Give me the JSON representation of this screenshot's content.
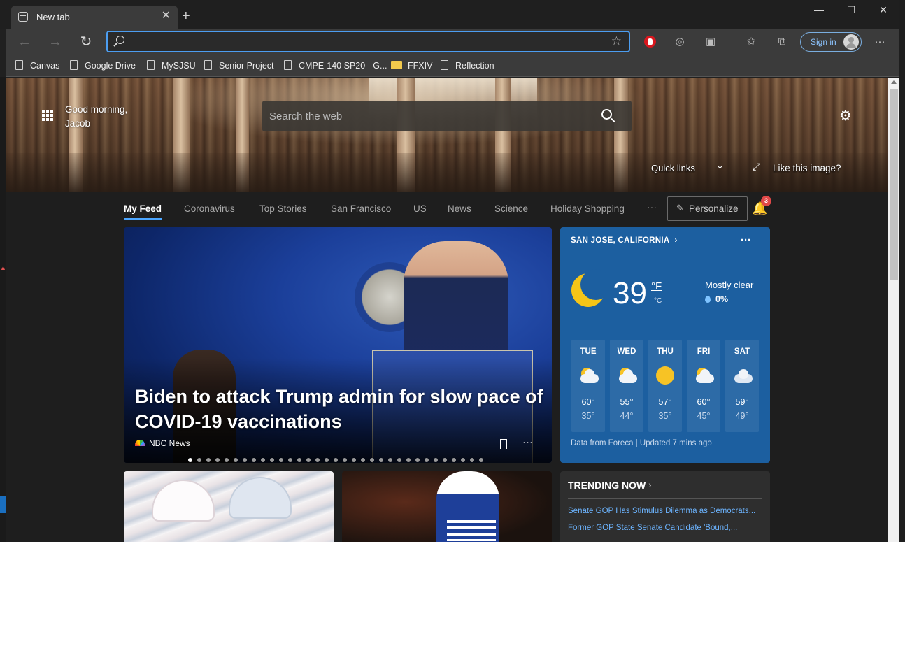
{
  "browser": {
    "tab_title": "New tab",
    "new_tab_symbol": "+",
    "window_controls": [
      "—",
      "☐",
      "✕"
    ],
    "address": {
      "value": "",
      "placeholder": ""
    },
    "sign_in_label": "Sign in",
    "bookmarks": [
      {
        "label": "Canvas",
        "icon": "page-icon"
      },
      {
        "label": "Google Drive",
        "icon": "page-icon"
      },
      {
        "label": "MySJSU",
        "icon": "page-icon"
      },
      {
        "label": "Senior Project",
        "icon": "page-icon"
      },
      {
        "label": "CMPE-140 SP20 - G...",
        "icon": "page-icon"
      },
      {
        "label": "FFXIV",
        "icon": "folder-icon"
      },
      {
        "label": "Reflection",
        "icon": "page-icon"
      }
    ]
  },
  "hero": {
    "greeting": "Good morning, Jacob",
    "search_placeholder": "Search the web",
    "quick_links_label": "Quick links",
    "like_image_label": "Like this image?"
  },
  "feed_nav": {
    "tabs": [
      "My Feed",
      "Coronavirus",
      "Top Stories",
      "San Francisco",
      "US",
      "News",
      "Science",
      "Holiday Shopping"
    ],
    "active_tab": "My Feed",
    "more_label": "···",
    "personalize_label": "Personalize",
    "notification_count": "3"
  },
  "main_story": {
    "headline": "Biden to attack Trump admin for slow pace of COVID-19 vaccinations",
    "source": "NBC News",
    "more_label": "···",
    "carousel_active_index": 0,
    "carousel_count": 33
  },
  "weather": {
    "location": "SAN JOSE, CALIFORNIA",
    "temperature": "39",
    "unit_f": "°F",
    "unit_c": "°C",
    "condition": "Mostly clear",
    "precipitation": "0%",
    "more_label": "···",
    "forecast": [
      {
        "day": "TUE",
        "high": "60°",
        "low": "35°",
        "icon": "partly-sunny"
      },
      {
        "day": "WED",
        "high": "55°",
        "low": "44°",
        "icon": "partly-sunny"
      },
      {
        "day": "THU",
        "high": "57°",
        "low": "35°",
        "icon": "sunny"
      },
      {
        "day": "FRI",
        "high": "60°",
        "low": "45°",
        "icon": "partly-sunny"
      },
      {
        "day": "SAT",
        "high": "59°",
        "low": "49°",
        "icon": "cloudy"
      }
    ],
    "footer": "Data from Foreca | Updated 7 mins ago"
  },
  "trending": {
    "title": "TRENDING NOW",
    "items": [
      "Senate GOP Has Stimulus Dilemma as Democrats...",
      "Former GOP State Senate Candidate 'Bound,..."
    ]
  },
  "colors": {
    "accent": "#4c9df0",
    "weather_bg": "#1c5fa0",
    "trending_link": "#6cb4ff",
    "badge": "#e04848"
  }
}
